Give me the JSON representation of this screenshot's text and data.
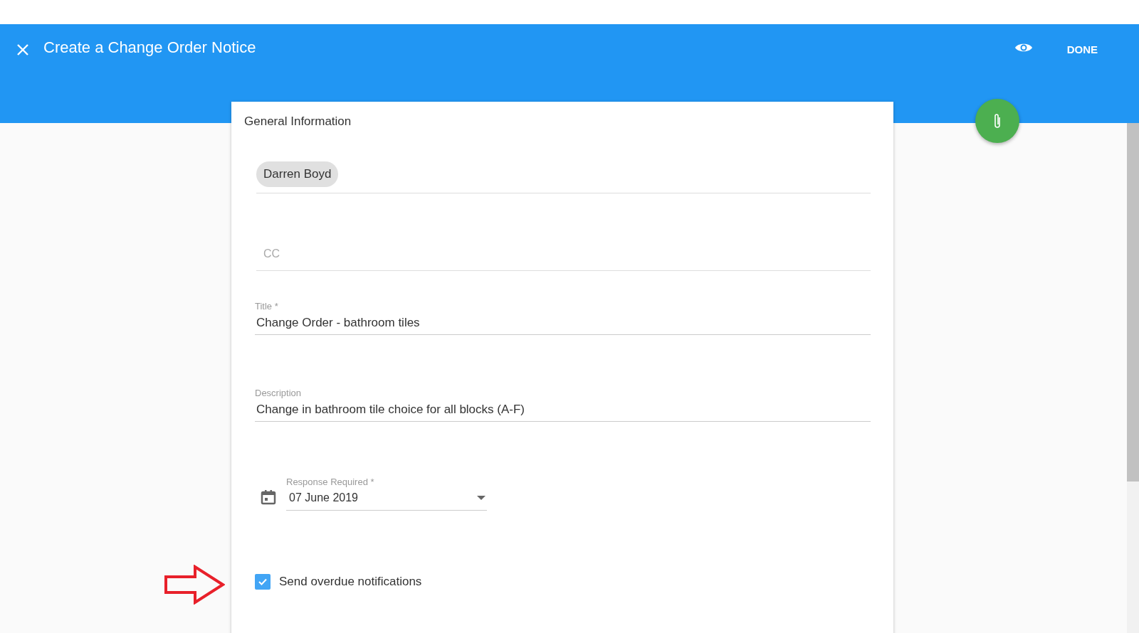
{
  "header": {
    "title": "Create a Change Order Notice",
    "done_button": "DONE"
  },
  "form": {
    "section_title": "General Information",
    "recipients": [
      "Darren Boyd"
    ],
    "cc": {
      "placeholder": "CC"
    },
    "fields": [
      {
        "label": "Title *",
        "value": "Change Order - bathroom tiles"
      },
      {
        "label": "Description",
        "value": "Change in bathroom tile choice for all blocks (A-F)"
      }
    ],
    "response_required": {
      "label": "Response Required *",
      "value": "07 June 2019"
    },
    "overdue_notifications": {
      "label": "Send overdue notifications",
      "checked": true
    }
  }
}
